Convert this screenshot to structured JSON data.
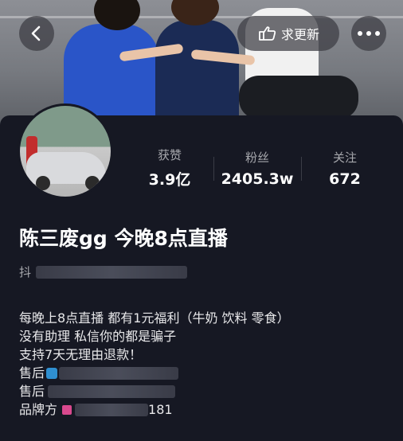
{
  "header": {
    "update_label": "求更新"
  },
  "icons": {
    "back": "chevron-left-icon",
    "update": "hand-point-icon",
    "more": "ellipsis-icon"
  },
  "stats": [
    {
      "label": "获赞",
      "value": "3.9亿"
    },
    {
      "label": "粉丝",
      "value": "2405.3w"
    },
    {
      "label": "关注",
      "value": "672"
    }
  ],
  "profile": {
    "nickname": "陈三废gg 今晚8点直播",
    "id_prefix": "抖"
  },
  "bio": {
    "line1": "每晚上8点直播 都有1元福利（牛奶 饮料 零食）",
    "line2": "没有助理 私信你的都是骗子",
    "line3": "支持7天无理由退款！",
    "line4": "售后",
    "line5": "售后",
    "line6_prefix": "品牌方",
    "line6_suffix": "181"
  },
  "colors": {
    "background": "#161823",
    "secondary_text": "#a7a8ad"
  }
}
